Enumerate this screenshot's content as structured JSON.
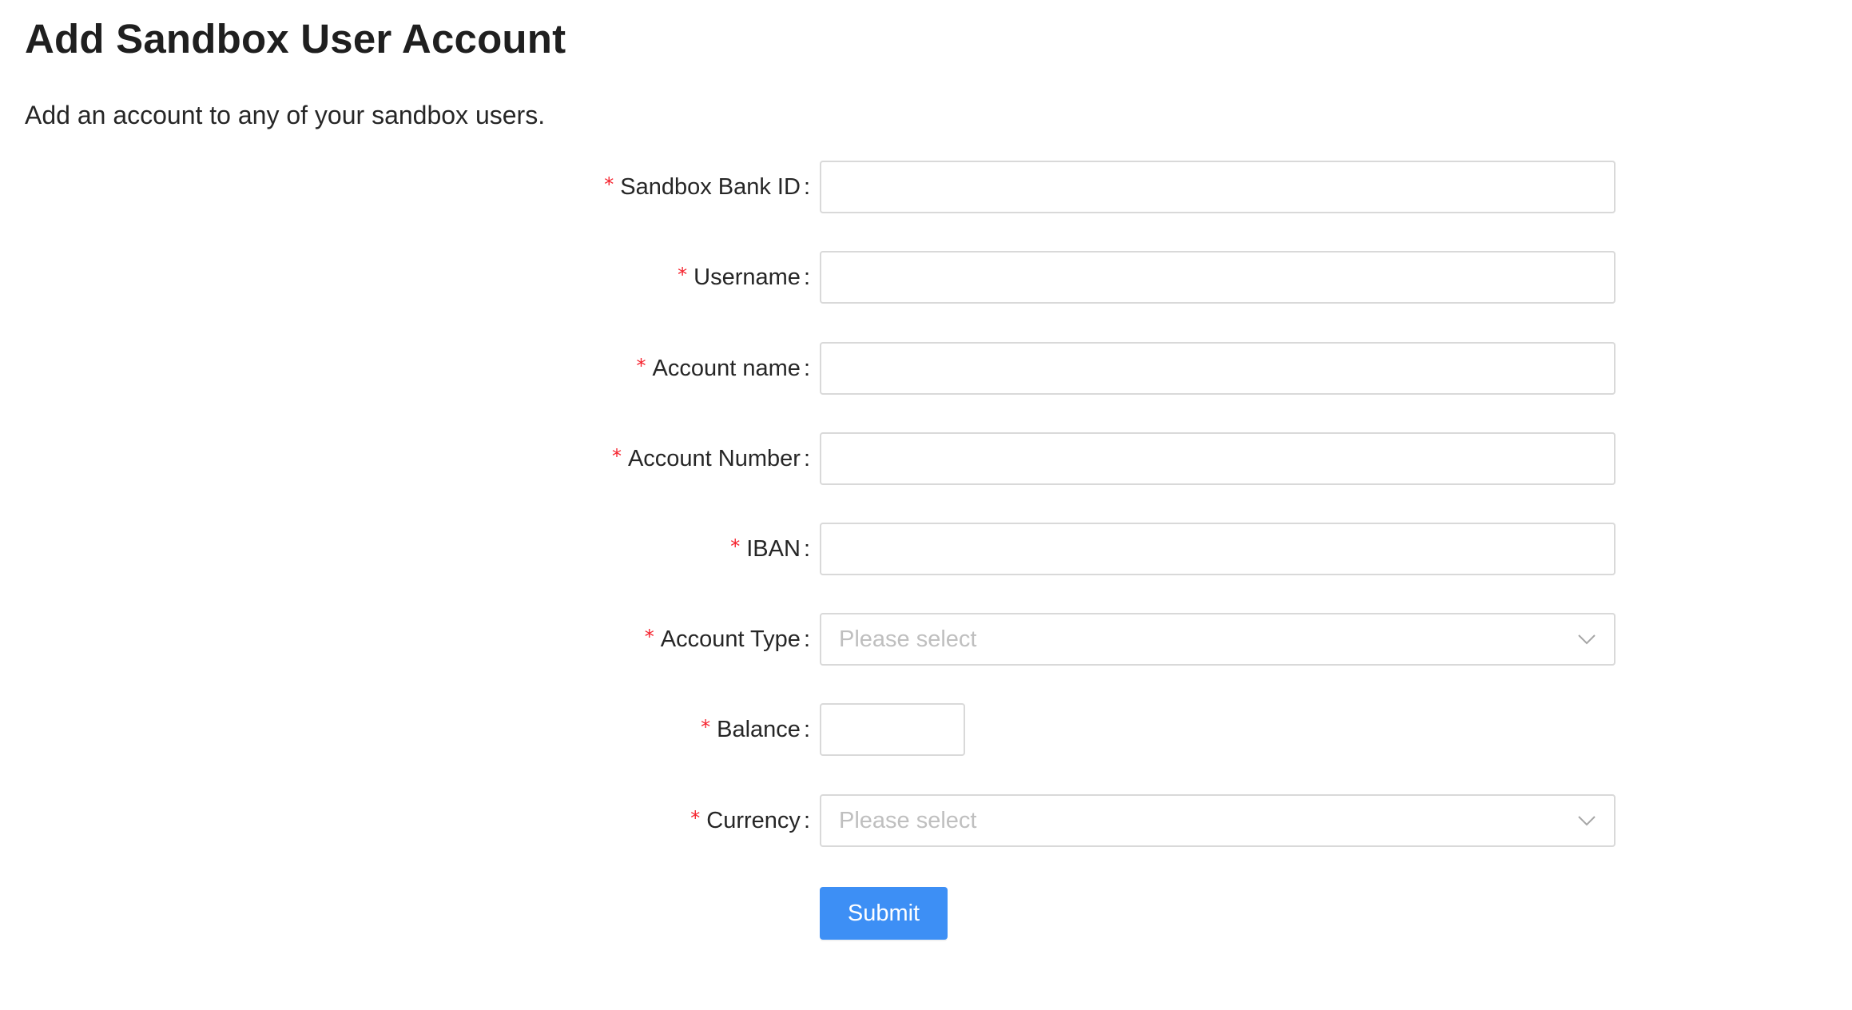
{
  "page": {
    "title": "Add Sandbox User Account",
    "subtitle": "Add an account to any of your sandbox users."
  },
  "form": {
    "required_marker": "*",
    "colon": ":",
    "fields": {
      "sandbox_bank_id": {
        "label": "Sandbox Bank ID",
        "value": "",
        "placeholder": ""
      },
      "username": {
        "label": "Username",
        "value": "",
        "placeholder": ""
      },
      "account_name": {
        "label": "Account name",
        "value": "",
        "placeholder": ""
      },
      "account_number": {
        "label": "Account Number",
        "value": "",
        "placeholder": ""
      },
      "iban": {
        "label": "IBAN",
        "value": "",
        "placeholder": ""
      },
      "account_type": {
        "label": "Account Type",
        "placeholder": "Please select",
        "icon": "chevron-down-icon"
      },
      "balance": {
        "label": "Balance",
        "value": "",
        "placeholder": ""
      },
      "currency": {
        "label": "Currency",
        "placeholder": "Please select",
        "icon": "chevron-down-icon"
      }
    },
    "submit_label": "Submit"
  },
  "colors": {
    "primary": "#3d8ff5",
    "required": "#f5222d",
    "border": "#d9d9d9",
    "placeholder": "#bfbfbf"
  }
}
